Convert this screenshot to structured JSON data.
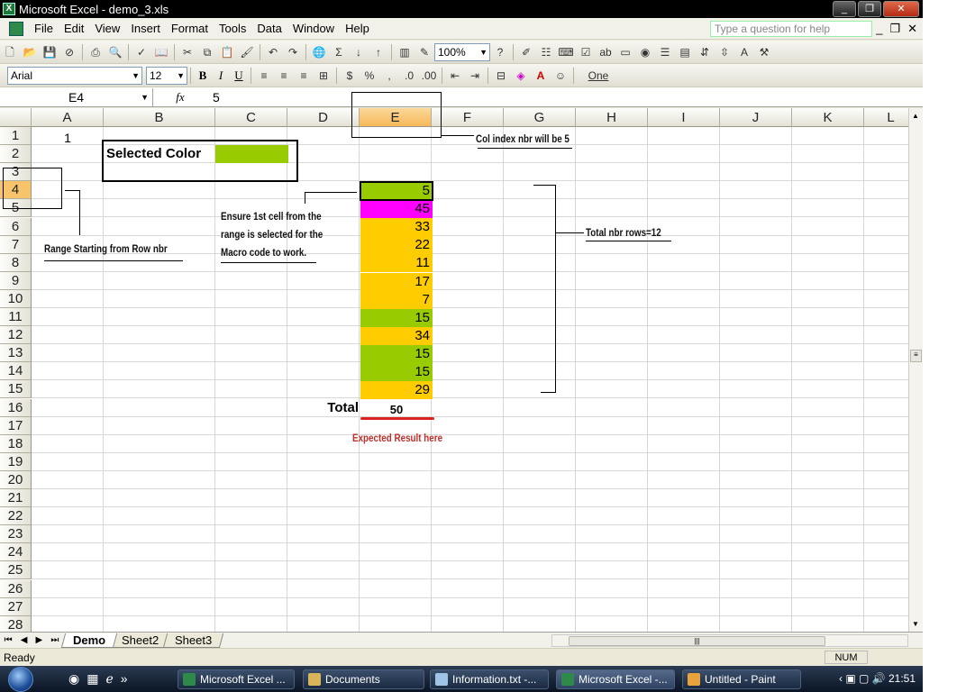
{
  "window": {
    "title": "Microsoft Excel - demo_3.xls",
    "controls": [
      "_",
      "❐",
      "✕"
    ]
  },
  "menu": {
    "items": [
      "File",
      "Edit",
      "View",
      "Insert",
      "Format",
      "Tools",
      "Data",
      "Window",
      "Help"
    ],
    "help_placeholder": "Type a question for help"
  },
  "toolbar": {
    "zoom": "100%",
    "font": "Arial",
    "font_size": "12",
    "style_box": "One"
  },
  "formula_bar": {
    "name_box": "E4",
    "fx": "fx",
    "value": "5"
  },
  "columns": [
    "A",
    "B",
    "C",
    "D",
    "E",
    "F",
    "G",
    "H",
    "I",
    "J",
    "K",
    "L"
  ],
  "rows": [
    "1",
    "2",
    "3",
    "4",
    "5",
    "6",
    "7",
    "8",
    "9",
    "10",
    "11",
    "12",
    "13",
    "14",
    "15",
    "16",
    "17",
    "18",
    "19",
    "20",
    "21",
    "22",
    "23",
    "24",
    "25",
    "26",
    "27",
    "28"
  ],
  "cells": {
    "A1": "1",
    "selected_color_label": "Selected Color",
    "e_values": [
      {
        "value": "5",
        "color": "#99cc00"
      },
      {
        "value": "45",
        "color": "#ff00ff"
      },
      {
        "value": "33",
        "color": "#ffcc00"
      },
      {
        "value": "22",
        "color": "#ffcc00"
      },
      {
        "value": "11",
        "color": "#ffcc00"
      },
      {
        "value": "17",
        "color": "#ffcc00"
      },
      {
        "value": "7",
        "color": "#ffcc00"
      },
      {
        "value": "15",
        "color": "#99cc00"
      },
      {
        "value": "34",
        "color": "#ffcc00"
      },
      {
        "value": "15",
        "color": "#99cc00"
      },
      {
        "value": "15",
        "color": "#99cc00"
      },
      {
        "value": "29",
        "color": "#ffcc00"
      }
    ],
    "total_label": "Total",
    "total_value": "50"
  },
  "annotations": {
    "col_index": "Col index nbr will be 5",
    "total_rows": "Total nbr rows=12",
    "range_start": "Range Starting from Row nbr",
    "ensure_line1": "Ensure 1st cell from the",
    "ensure_line2": "range is selected for the",
    "ensure_line3": "Macro code to work.",
    "expected": "Expected Result here"
  },
  "sheets": {
    "tabs": [
      "Demo",
      "Sheet2",
      "Sheet3"
    ],
    "active": "Demo"
  },
  "status": {
    "left": "Ready",
    "num": "NUM"
  },
  "taskbar": {
    "tasks": [
      "Microsoft Excel ...",
      "Documents",
      "Information.txt -...",
      "Microsoft Excel -...",
      "Untitled - Paint"
    ],
    "clock": "21:51"
  }
}
